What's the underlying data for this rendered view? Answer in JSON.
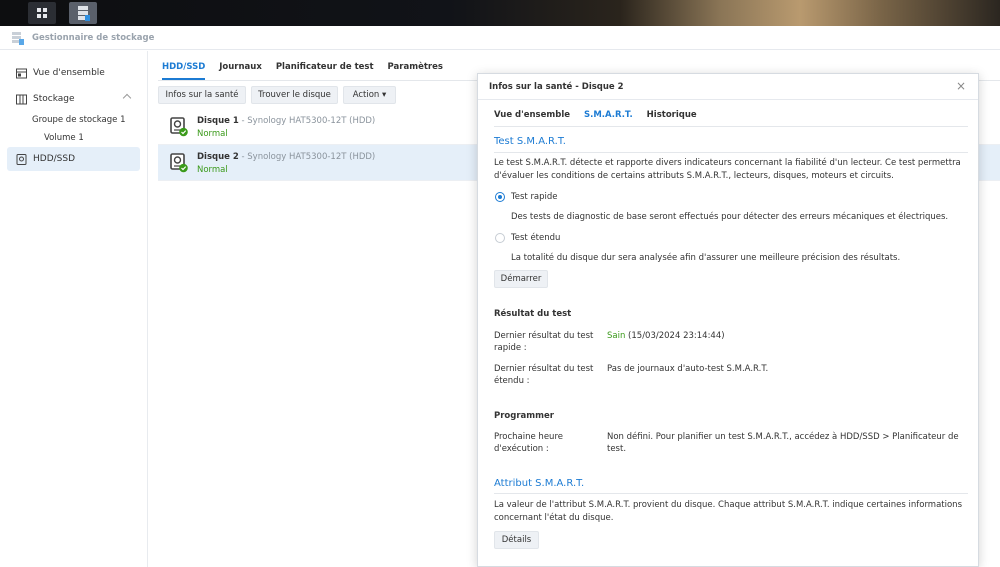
{
  "app": {
    "title": "Gestionnaire de stockage"
  },
  "sidebar": {
    "items": [
      {
        "label": "Vue d'ensemble",
        "icon": "overview-icon"
      },
      {
        "label": "Stockage",
        "icon": "storage-icon"
      },
      {
        "label": "HDD/SSD",
        "icon": "disk-icon"
      }
    ],
    "sub": {
      "pool": "Groupe de stockage 1",
      "volume": "Volume 1"
    }
  },
  "main": {
    "tabs": [
      "HDD/SSD",
      "Journaux",
      "Planificateur de test",
      "Paramètres"
    ],
    "toolbar": {
      "health": "Infos sur la santé",
      "find": "Trouver le disque",
      "action": "Action ▾"
    },
    "disks": [
      {
        "name": "Disque 1",
        "model": " - Synology HAT5300-12T (HDD)",
        "status": "Normal"
      },
      {
        "name": "Disque 2",
        "model": " - Synology HAT5300-12T (HDD)",
        "status": "Normal"
      }
    ]
  },
  "dialog": {
    "title": "Infos sur la santé - Disque 2",
    "close": "×",
    "tabs": [
      "Vue d'ensemble",
      "S.M.A.R.T.",
      "Historique"
    ],
    "smart_test": {
      "title": "Test S.M.A.R.T.",
      "desc": "Le test S.M.A.R.T. détecte et rapporte divers indicateurs concernant la fiabilité d'un lecteur. Ce test permettra d'évaluer les conditions de certains attributs S.M.A.R.T., lecteurs, disques, moteurs et circuits.",
      "quick_label": "Test rapide",
      "quick_desc": "Des tests de diagnostic de base seront effectués pour détecter des erreurs mécaniques et électriques.",
      "extended_label": "Test étendu",
      "extended_desc": "La totalité du disque dur sera analysée afin d'assurer une meilleure précision des résultats.",
      "start": "Démarrer"
    },
    "result": {
      "title": "Résultat du test",
      "last_quick_key": "Dernier résultat du test rapide :",
      "last_quick_status": "Sain",
      "last_quick_time": " (15/03/2024 23:14:44)",
      "last_ext_key": "Dernier résultat du test étendu :",
      "last_ext_val": "Pas de journaux d'auto-test S.M.A.R.T."
    },
    "schedule": {
      "title": "Programmer",
      "next_key": "Prochaine heure d'exécution :",
      "next_val": "Non défini. Pour planifier un test S.M.A.R.T., accédez à HDD/SSD > Planificateur de test."
    },
    "attribute": {
      "title": "Attribut S.M.A.R.T.",
      "desc": "La valeur de l'attribut S.M.A.R.T. provient du disque. Chaque attribut S.M.A.R.T. indique certaines informations concernant l'état du disque.",
      "details": "Détails"
    }
  },
  "colors": {
    "accent": "#1c7bd3",
    "healthy": "#3a9a1a",
    "selection": "#e5eff9"
  }
}
